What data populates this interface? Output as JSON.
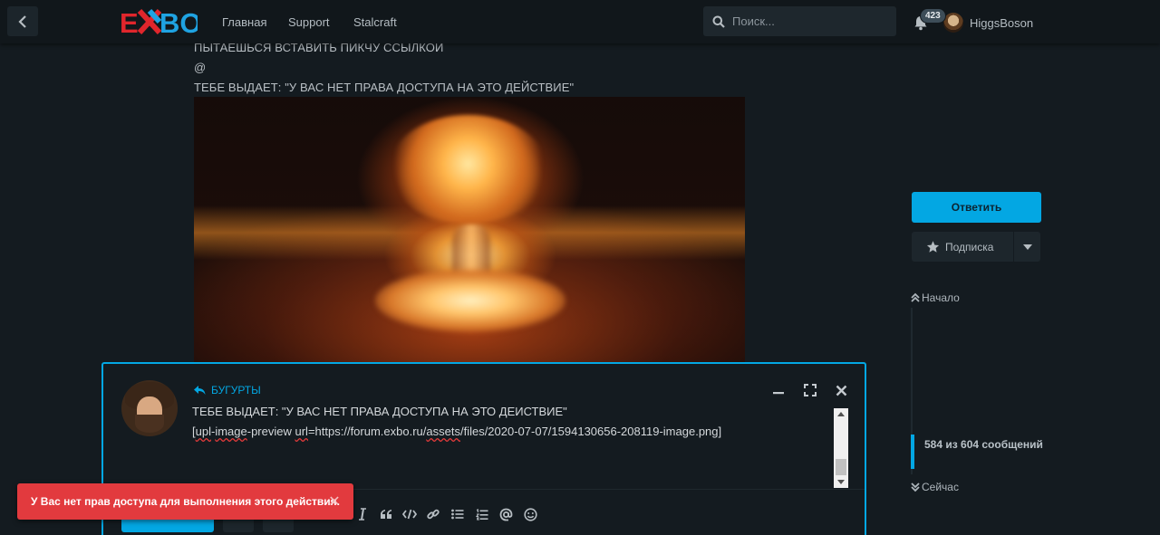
{
  "header": {
    "logo_text": "EXBO",
    "nav": [
      "Главная",
      "Support",
      "Stalcraft"
    ],
    "search_placeholder": "Поиск...",
    "notifications_count": "423",
    "username": "HiggsBoson"
  },
  "post": {
    "lines": [
      "ПЫТАЕШЬСЯ ВСТАВИТЬ ПИКЧУ ССЫЛКОЙ",
      "@",
      "ТЕБЕ ВЫДАЕТ: \"У ВАС НЕТ ПРАВА ДОСТУПА НА ЭТО ДЕЙСТВИЕ\""
    ]
  },
  "sidebar": {
    "reply_label": "Ответить",
    "subscribe_label": "Подписка",
    "scrub_top": "Начало",
    "scrub_position": "584 из 604 сообщений",
    "scrub_bottom": "Сейчас"
  },
  "composer": {
    "reply_to": "БУГУРТЫ",
    "editor_line1": "ТЕБЕ ВЫДАЕТ: \"У ВАС НЕТ ПРАВА ДОСТУПА НА ЭТО ДЕЙСТВИЕ\"",
    "editor_line2_parts": [
      "[",
      "upl",
      "-",
      "image",
      "-preview ",
      "url",
      "=https://forum.exbo.ru/",
      "assets",
      "/files/2020-07-07/1594130656-208119-image.png]"
    ],
    "tools": [
      "italic-icon",
      "quote-icon",
      "code-icon",
      "link-icon",
      "bullet-list-icon",
      "numbered-list-icon",
      "mention-icon",
      "emoji-icon"
    ]
  },
  "toast": {
    "message": "У Вас нет прав доступа для выполнения этого действия.",
    "close": "✕"
  },
  "colors": {
    "accent": "#03a7e3",
    "background": "#141b20",
    "header": "#11171b",
    "alert": "#e23a3e",
    "logo_red": "#e0262c",
    "logo_blue": "#1fa3e2"
  }
}
